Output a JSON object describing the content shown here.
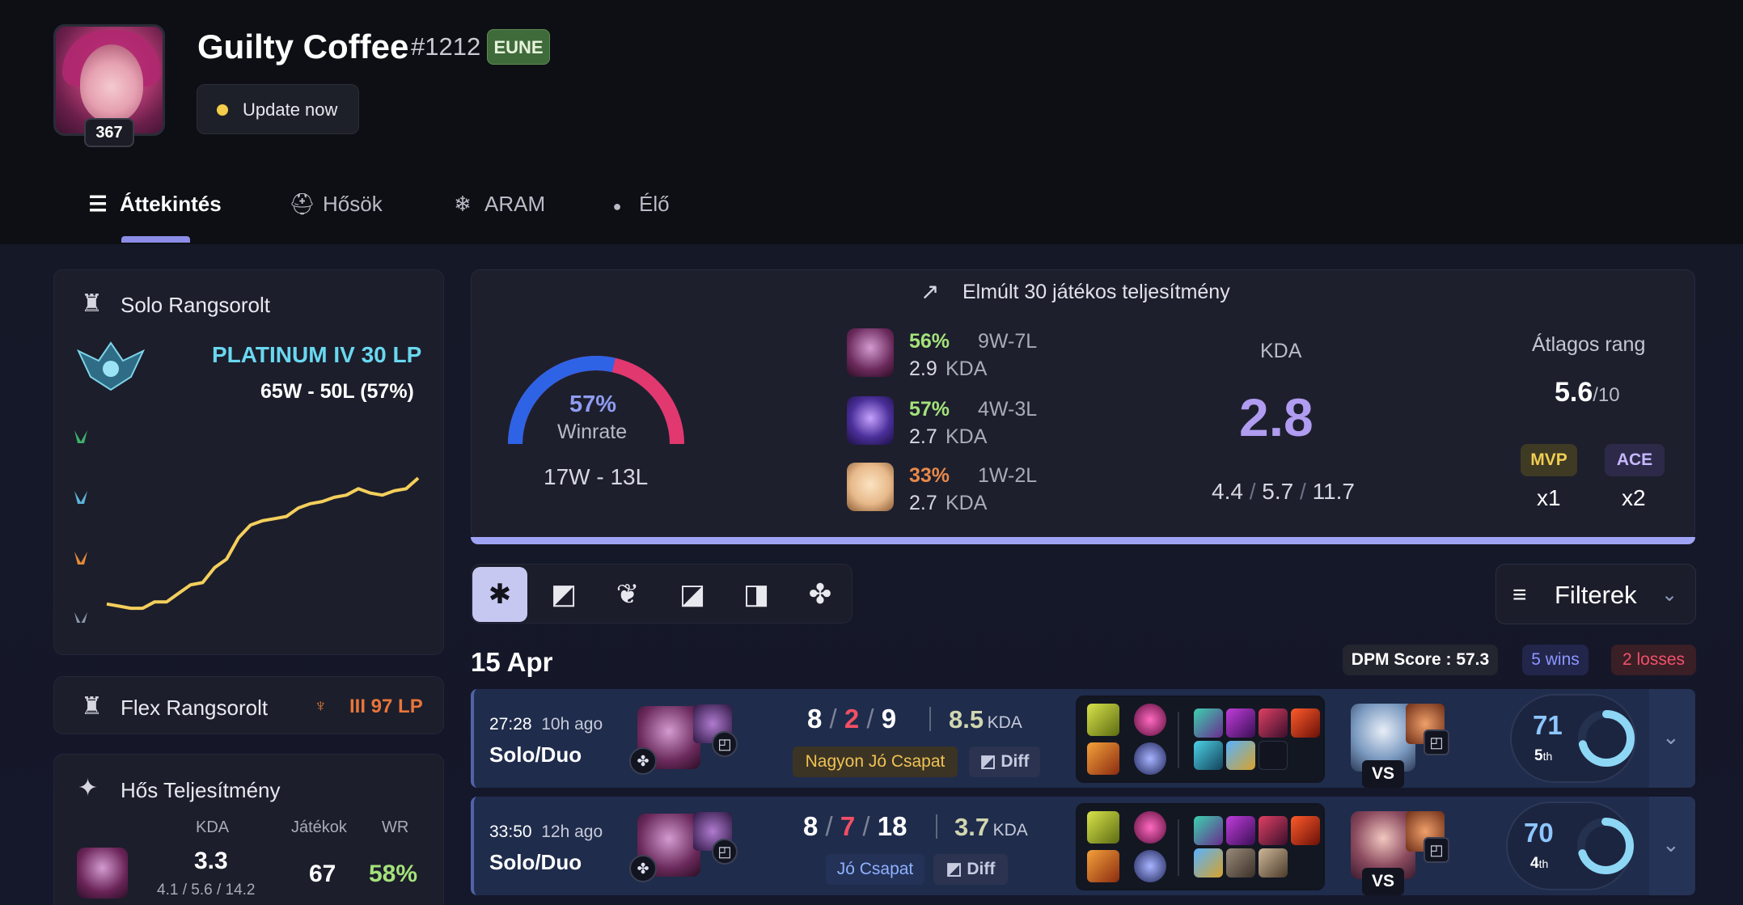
{
  "profile": {
    "name": "Guilty Coffee",
    "tag": "#1212",
    "region": "EUNE",
    "level": "367",
    "update_label": "Update now"
  },
  "tabs": [
    {
      "label": "Áttekintés",
      "icon": "grid-list-icon",
      "active": true
    },
    {
      "label": "Hősök",
      "icon": "helmet-icon",
      "active": false
    },
    {
      "label": "ARAM",
      "icon": "snowflake-icon",
      "active": false
    },
    {
      "label": "Élő",
      "icon": "live-dot-icon",
      "active": false
    }
  ],
  "solo": {
    "title": "Solo Rangsorolt",
    "rank": "PLATINUM IV 30 LP",
    "record": "65W - 50L (57%)",
    "lp_history": [
      0.05,
      0.04,
      0.03,
      0.03,
      0.06,
      0.06,
      0.1,
      0.14,
      0.15,
      0.22,
      0.26,
      0.36,
      0.42,
      0.44,
      0.45,
      0.46,
      0.5,
      0.52,
      0.53,
      0.55,
      0.56,
      0.59,
      0.57,
      0.56,
      0.58,
      0.59,
      0.64
    ]
  },
  "flex": {
    "title": "Flex Rangsorolt",
    "rank": "III 97 LP"
  },
  "hero_perf": {
    "title": "Hős Teljesítmény",
    "cols": [
      "KDA",
      "Játékok",
      "WR"
    ],
    "kda": "3.3",
    "kda_detail": "4.1 / 5.6 / 14.2",
    "games": "67",
    "wr": "58%"
  },
  "last30": {
    "title": "Elmúlt 30 játékos teljesítmény",
    "winrate_pct": "57%",
    "winrate_label": "Winrate",
    "record": "17W - 13L",
    "winrate": 57,
    "champions": [
      {
        "pct": "56%",
        "wl": "9W-7L",
        "kda": "2.9",
        "kda_label": "KDA",
        "color": "#a4e27a",
        "img": "#6b2a5c"
      },
      {
        "pct": "57%",
        "wl": "4W-3L",
        "kda": "2.7",
        "kda_label": "KDA",
        "color": "#a4e27a",
        "img": "#4a2f9a"
      },
      {
        "pct": "33%",
        "wl": "1W-2L",
        "kda": "2.7",
        "kda_label": "KDA",
        "color": "#e8894a",
        "img": "#e7b98a"
      }
    ],
    "kda_label": "KDA",
    "kda": "2.8",
    "kda_detail_k": "4.4",
    "kda_detail_d": "5.7",
    "kda_detail_a": "11.7",
    "avg_rank_label": "Átlagos rang",
    "avg_rank": "5.6",
    "avg_rank_max": "/10",
    "mvp_label": "MVP",
    "mvp_count": "x1",
    "ace_label": "ACE",
    "ace_count": "x2"
  },
  "filters": {
    "label": "Filterek",
    "roles": [
      "all-roles-icon",
      "top-lane-icon",
      "jungle-icon",
      "mid-lane-icon",
      "bot-lane-icon",
      "support-icon"
    ]
  },
  "date_group": {
    "date": "15 Apr",
    "dpm": "DPM Score : 57.3",
    "wins": "5 wins",
    "losses": "2 losses"
  },
  "matches": [
    {
      "duration": "27:28",
      "ago": "10h ago",
      "queue": "Solo/Duo",
      "k": "8",
      "d": "2",
      "a": "9",
      "ratio": "8.5",
      "ratio_label": "KDA",
      "tag": "Nagyon Jó Csapat",
      "tag_color": "#f0c255",
      "tag_bg": "#3b3424",
      "diff": "Diff",
      "vs": "VS",
      "score": "71",
      "place": "5",
      "place_suffix": "th",
      "score_frac": 0.71
    },
    {
      "duration": "33:50",
      "ago": "12h ago",
      "queue": "Solo/Duo",
      "k": "8",
      "d": "7",
      "a": "18",
      "ratio": "3.7",
      "ratio_label": "KDA",
      "tag": "Jó Csapat",
      "tag_color": "#8fb2ff",
      "tag_bg": "#243258",
      "diff": "Diff",
      "vs": "VS",
      "score": "70",
      "place": "4",
      "place_suffix": "th",
      "score_frac": 0.7
    }
  ]
}
